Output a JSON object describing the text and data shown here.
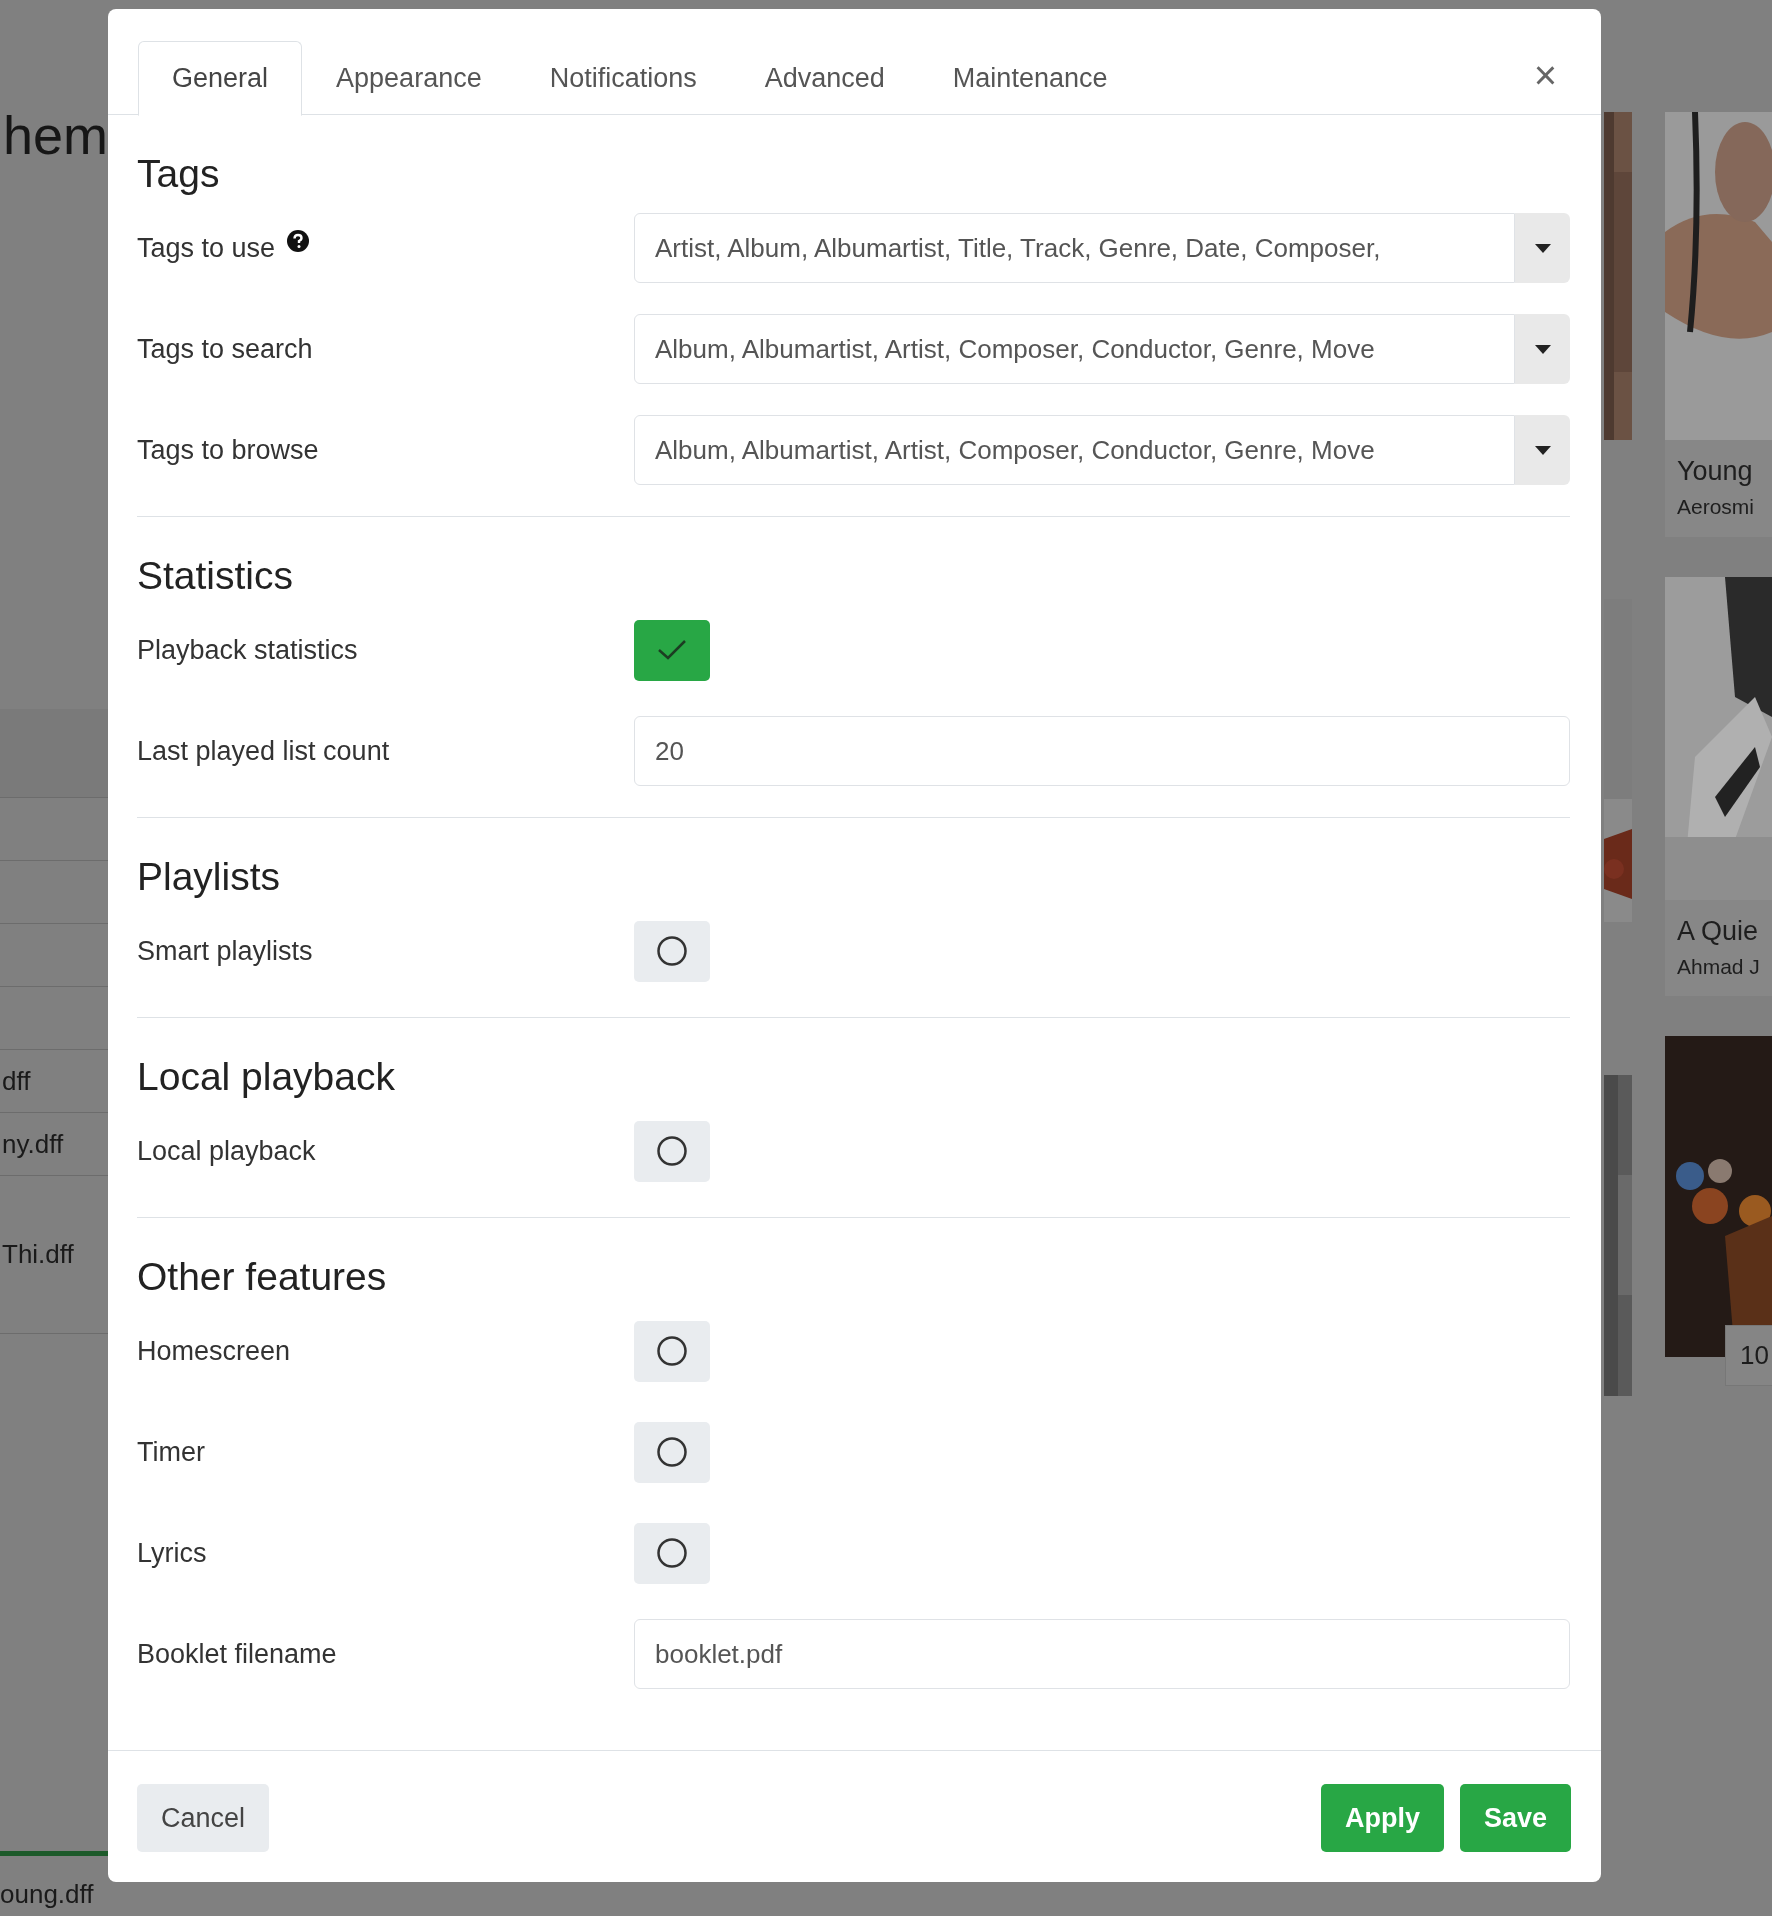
{
  "background": {
    "heading": "hem",
    "files": [
      "dff",
      "ny.dff",
      "Thi.dff"
    ],
    "now_playing": "oung.dff",
    "albums": [
      {
        "title": "Young",
        "artist": "Aerosmi"
      },
      {
        "title": "A Quie",
        "artist": "Ahmad J"
      }
    ],
    "page_number": "10"
  },
  "dialog": {
    "tabs": [
      {
        "label": "General",
        "selected": true
      },
      {
        "label": "Appearance",
        "selected": false
      },
      {
        "label": "Notifications",
        "selected": false
      },
      {
        "label": "Advanced",
        "selected": false
      },
      {
        "label": "Maintenance",
        "selected": false
      }
    ],
    "close": "×",
    "sections": [
      {
        "title": "Tags",
        "rows": [
          {
            "kind": "select",
            "label": "Tags to use",
            "help": true,
            "value": "Artist, Album, Albumartist, Title, Track, Genre, Date, Composer,"
          },
          {
            "kind": "select",
            "label": "Tags to search",
            "help": false,
            "value": "Album, Albumartist, Artist, Composer, Conductor, Genre, Move"
          },
          {
            "kind": "select",
            "label": "Tags to browse",
            "help": false,
            "value": "Album, Albumartist, Artist, Composer, Conductor, Genre, Move"
          }
        ]
      },
      {
        "title": "Statistics",
        "rows": [
          {
            "kind": "toggle",
            "label": "Playback statistics",
            "help": false,
            "checked": true
          },
          {
            "kind": "input",
            "label": "Last played list count",
            "help": false,
            "value": "20"
          }
        ]
      },
      {
        "title": "Playlists",
        "rows": [
          {
            "kind": "toggle",
            "label": "Smart playlists",
            "help": false,
            "checked": false
          }
        ]
      },
      {
        "title": "Local playback",
        "rows": [
          {
            "kind": "toggle",
            "label": "Local playback",
            "help": false,
            "checked": false
          }
        ]
      },
      {
        "title": "Other features",
        "rows": [
          {
            "kind": "toggle",
            "label": "Homescreen",
            "help": false,
            "checked": false
          },
          {
            "kind": "toggle",
            "label": "Timer",
            "help": false,
            "checked": false
          },
          {
            "kind": "toggle",
            "label": "Lyrics",
            "help": false,
            "checked": false
          },
          {
            "kind": "input",
            "label": "Booklet filename",
            "help": false,
            "value": "booklet.pdf"
          }
        ]
      }
    ],
    "buttons": [
      {
        "label": "Cancel",
        "kind": "secondary"
      },
      {
        "label": "Apply",
        "kind": "primary"
      },
      {
        "label": "Save",
        "kind": "primary"
      }
    ]
  }
}
